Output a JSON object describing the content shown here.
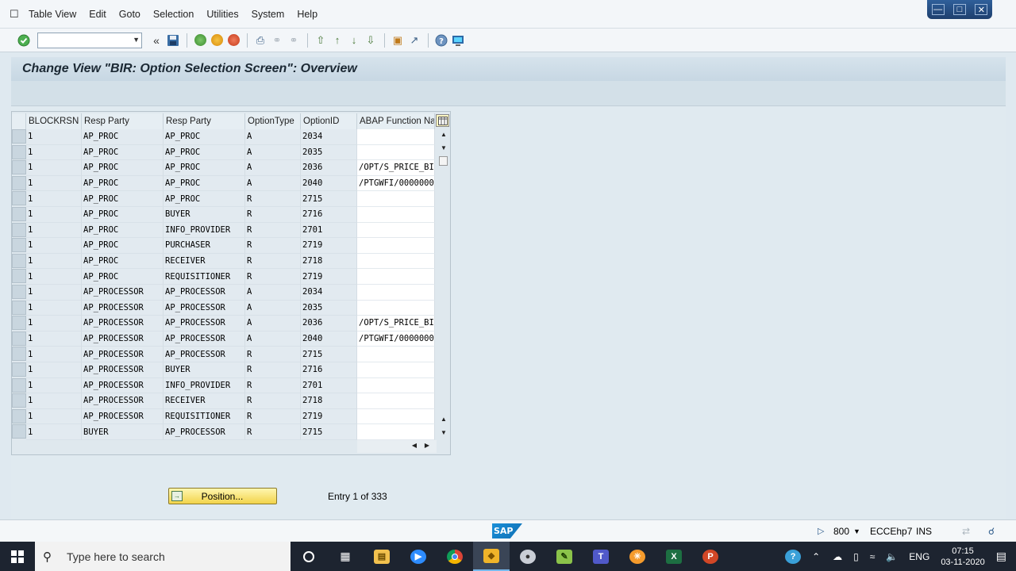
{
  "menu": {
    "items": [
      "Table View",
      "Edit",
      "Goto",
      "Selection",
      "Utilities",
      "System",
      "Help"
    ]
  },
  "toolbar": {
    "command_value": "",
    "icons": [
      "enter-icon",
      "back-icon",
      "save-icon",
      "green-back-icon",
      "exit-icon",
      "cancel-icon",
      "print-icon",
      "find-icon",
      "find-next-icon",
      "first-page-icon",
      "previous-page-icon",
      "next-page-icon",
      "last-page-icon",
      "create-session-icon",
      "shortcut-icon",
      "help-icon",
      "customize-layout-icon"
    ]
  },
  "page": {
    "title": "Change View \"BIR: Option Selection Screen\": Overview"
  },
  "table": {
    "columns": [
      "BLOCKRSN",
      "Resp Party",
      "Resp Party",
      "OptionType",
      "OptionID",
      "ABAP Function Nar"
    ],
    "rows": [
      [
        "1",
        "AP_PROC",
        "AP_PROC",
        "A",
        "2034",
        ""
      ],
      [
        "1",
        "AP_PROC",
        "AP_PROC",
        "A",
        "2035",
        ""
      ],
      [
        "1",
        "AP_PROC",
        "AP_PROC",
        "A",
        "2036",
        "/OPT/S_PRICE_BI"
      ],
      [
        "1",
        "AP_PROC",
        "AP_PROC",
        "A",
        "2040",
        "/PTGWFI/0000000"
      ],
      [
        "1",
        "AP_PROC",
        "AP_PROC",
        "R",
        "2715",
        ""
      ],
      [
        "1",
        "AP_PROC",
        "BUYER",
        "R",
        "2716",
        ""
      ],
      [
        "1",
        "AP_PROC",
        "INFO_PROVIDER",
        "R",
        "2701",
        ""
      ],
      [
        "1",
        "AP_PROC",
        "PURCHASER",
        "R",
        "2719",
        ""
      ],
      [
        "1",
        "AP_PROC",
        "RECEIVER",
        "R",
        "2718",
        ""
      ],
      [
        "1",
        "AP_PROC",
        "REQUISITIONER",
        "R",
        "2719",
        ""
      ],
      [
        "1",
        "AP_PROCESSOR",
        "AP_PROCESSOR",
        "A",
        "2034",
        ""
      ],
      [
        "1",
        "AP_PROCESSOR",
        "AP_PROCESSOR",
        "A",
        "2035",
        ""
      ],
      [
        "1",
        "AP_PROCESSOR",
        "AP_PROCESSOR",
        "A",
        "2036",
        "/OPT/S_PRICE_BI"
      ],
      [
        "1",
        "AP_PROCESSOR",
        "AP_PROCESSOR",
        "A",
        "2040",
        "/PTGWFI/0000000"
      ],
      [
        "1",
        "AP_PROCESSOR",
        "AP_PROCESSOR",
        "R",
        "2715",
        ""
      ],
      [
        "1",
        "AP_PROCESSOR",
        "BUYER",
        "R",
        "2716",
        ""
      ],
      [
        "1",
        "AP_PROCESSOR",
        "INFO_PROVIDER",
        "R",
        "2701",
        ""
      ],
      [
        "1",
        "AP_PROCESSOR",
        "RECEIVER",
        "R",
        "2718",
        ""
      ],
      [
        "1",
        "AP_PROCESSOR",
        "REQUISITIONER",
        "R",
        "2719",
        ""
      ],
      [
        "1",
        "BUYER",
        "AP_PROCESSOR",
        "R",
        "2715",
        ""
      ]
    ]
  },
  "footer": {
    "position_label": "Position...",
    "entry_text": "Entry 1 of 333"
  },
  "status": {
    "client": "800",
    "system": "ECCEhp7",
    "mode": "INS",
    "logo_text": "SAP"
  },
  "taskbar": {
    "search_placeholder": "Type here to search",
    "language": "ENG",
    "time": "07:15",
    "date": "03-11-2020"
  },
  "colors": {
    "sap_blue": "#1a8fd8",
    "taskbar_bg": "#1d2430",
    "position_button": "#f2d34a"
  }
}
